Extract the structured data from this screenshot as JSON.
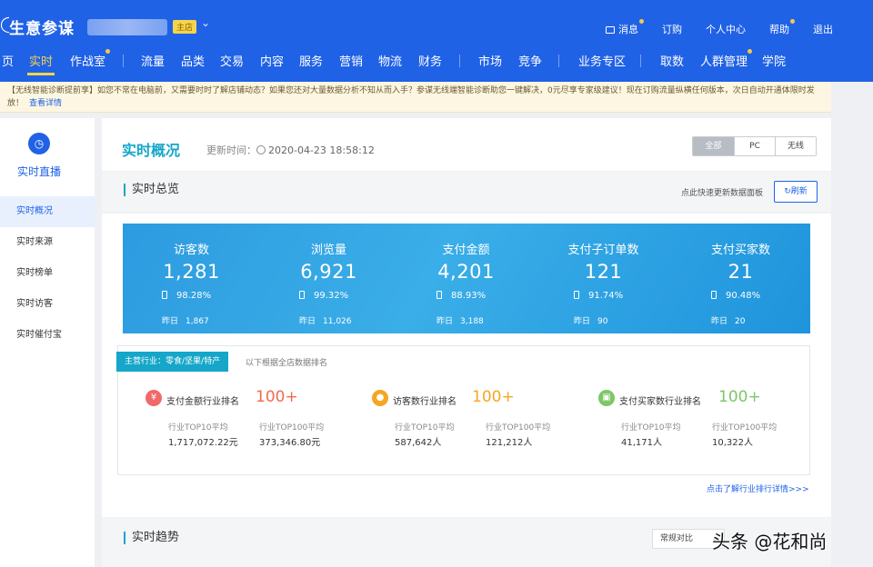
{
  "header": {
    "logo": "生意参谋",
    "shop_badge": "主店",
    "top_links": [
      {
        "label": "消息",
        "dot": true,
        "icon": "mail-icon"
      },
      {
        "label": "订购",
        "dot": false
      },
      {
        "label": "个人中心",
        "dot": false
      },
      {
        "label": "帮助",
        "dot": true
      },
      {
        "label": "退出",
        "dot": false
      }
    ],
    "nav": [
      {
        "label": "页",
        "active": false
      },
      {
        "label": "实时",
        "active": true
      },
      {
        "label": "作战室",
        "active": false,
        "dot": true
      },
      {
        "label": "流量",
        "active": false
      },
      {
        "label": "品类",
        "active": false
      },
      {
        "label": "交易",
        "active": false
      },
      {
        "label": "内容",
        "active": false
      },
      {
        "label": "服务",
        "active": false
      },
      {
        "label": "营销",
        "active": false
      },
      {
        "label": "物流",
        "active": false
      },
      {
        "label": "财务",
        "active": false
      },
      {
        "label": "市场",
        "active": false
      },
      {
        "label": "竞争",
        "active": false
      },
      {
        "label": "业务专区",
        "active": false
      },
      {
        "label": "取数",
        "active": false
      },
      {
        "label": "人群管理",
        "active": false,
        "dot": true
      },
      {
        "label": "学院",
        "active": false
      }
    ]
  },
  "notice": {
    "text": "【无线智能诊断提前享】如您不常在电脑前，又需要时时了解店铺动态？如果您还对大量数据分析不知从而入手？参谋无线端智能诊断助您一键解决，0元尽享专家级建议！现在订购流量纵横任何版本，次日自动开通体限时发放！",
    "link": "查看详情"
  },
  "sidebar": {
    "title": "实时直播",
    "icon": "clock-icon",
    "items": [
      {
        "label": "实时概况",
        "active": true
      },
      {
        "label": "实时来源",
        "active": false
      },
      {
        "label": "实时榜单",
        "active": false
      },
      {
        "label": "实时访客",
        "active": false
      },
      {
        "label": "实时催付宝",
        "active": false
      }
    ]
  },
  "overview": {
    "title": "实时概况",
    "update_label": "更新时间：",
    "update_time": "2020-04-23 18:58:12",
    "segments": [
      {
        "label": "全部",
        "active": true
      },
      {
        "label": "PC",
        "active": false
      },
      {
        "label": "无线",
        "active": false
      }
    ]
  },
  "summary": {
    "title": "实时总览",
    "refresh_hint": "点此快速更新数据面板",
    "refresh_label": "刷新",
    "stats": [
      {
        "label": "访客数",
        "value": "1,281",
        "mobile_pct": "98.28%",
        "yesterday_label": "昨日",
        "yesterday": "1,867"
      },
      {
        "label": "浏览量",
        "value": "6,921",
        "mobile_pct": "99.32%",
        "yesterday_label": "昨日",
        "yesterday": "11,026"
      },
      {
        "label": "支付金额",
        "value": "4,201",
        "mobile_pct": "88.93%",
        "yesterday_label": "昨日",
        "yesterday": "3,188"
      },
      {
        "label": "支付子订单数",
        "value": "121",
        "mobile_pct": "91.74%",
        "yesterday_label": "昨日",
        "yesterday": "90"
      },
      {
        "label": "支付买家数",
        "value": "21",
        "mobile_pct": "90.48%",
        "yesterday_label": "昨日",
        "yesterday": "20"
      }
    ]
  },
  "industry": {
    "tag": "主营行业：零食/坚果/特产",
    "hint": "以下根据全店数据排名",
    "ranks": [
      {
        "name": "支付金额行业排名",
        "rank": "100+",
        "icon": "yen-icon",
        "icon_color": "#f0686a",
        "rank_color": "#f26a4b",
        "c1_label": "行业TOP10平均",
        "c1_value": "1,717,072.22元",
        "c2_label": "行业TOP100平均",
        "c2_value": "373,346.80元"
      },
      {
        "name": "访客数行业排名",
        "rank": "100+",
        "icon": "user-icon",
        "icon_color": "#f5a623",
        "rank_color": "#f5a623",
        "c1_label": "行业TOP10平均",
        "c1_value": "587,642人",
        "c2_label": "行业TOP100平均",
        "c2_value": "121,212人"
      },
      {
        "name": "支付买家数行业排名",
        "rank": "100+",
        "icon": "buyer-icon",
        "icon_color": "#7cc768",
        "rank_color": "#7cc768",
        "c1_label": "行业TOP10平均",
        "c1_value": "41,171人",
        "c2_label": "行业TOP100平均",
        "c2_value": "10,322人"
      }
    ],
    "more_link": "点击了解行业排行详情>>>"
  },
  "trend": {
    "title": "实时趋势",
    "compare_value": "常规对比"
  },
  "watermark": "头条 @花和尚"
}
